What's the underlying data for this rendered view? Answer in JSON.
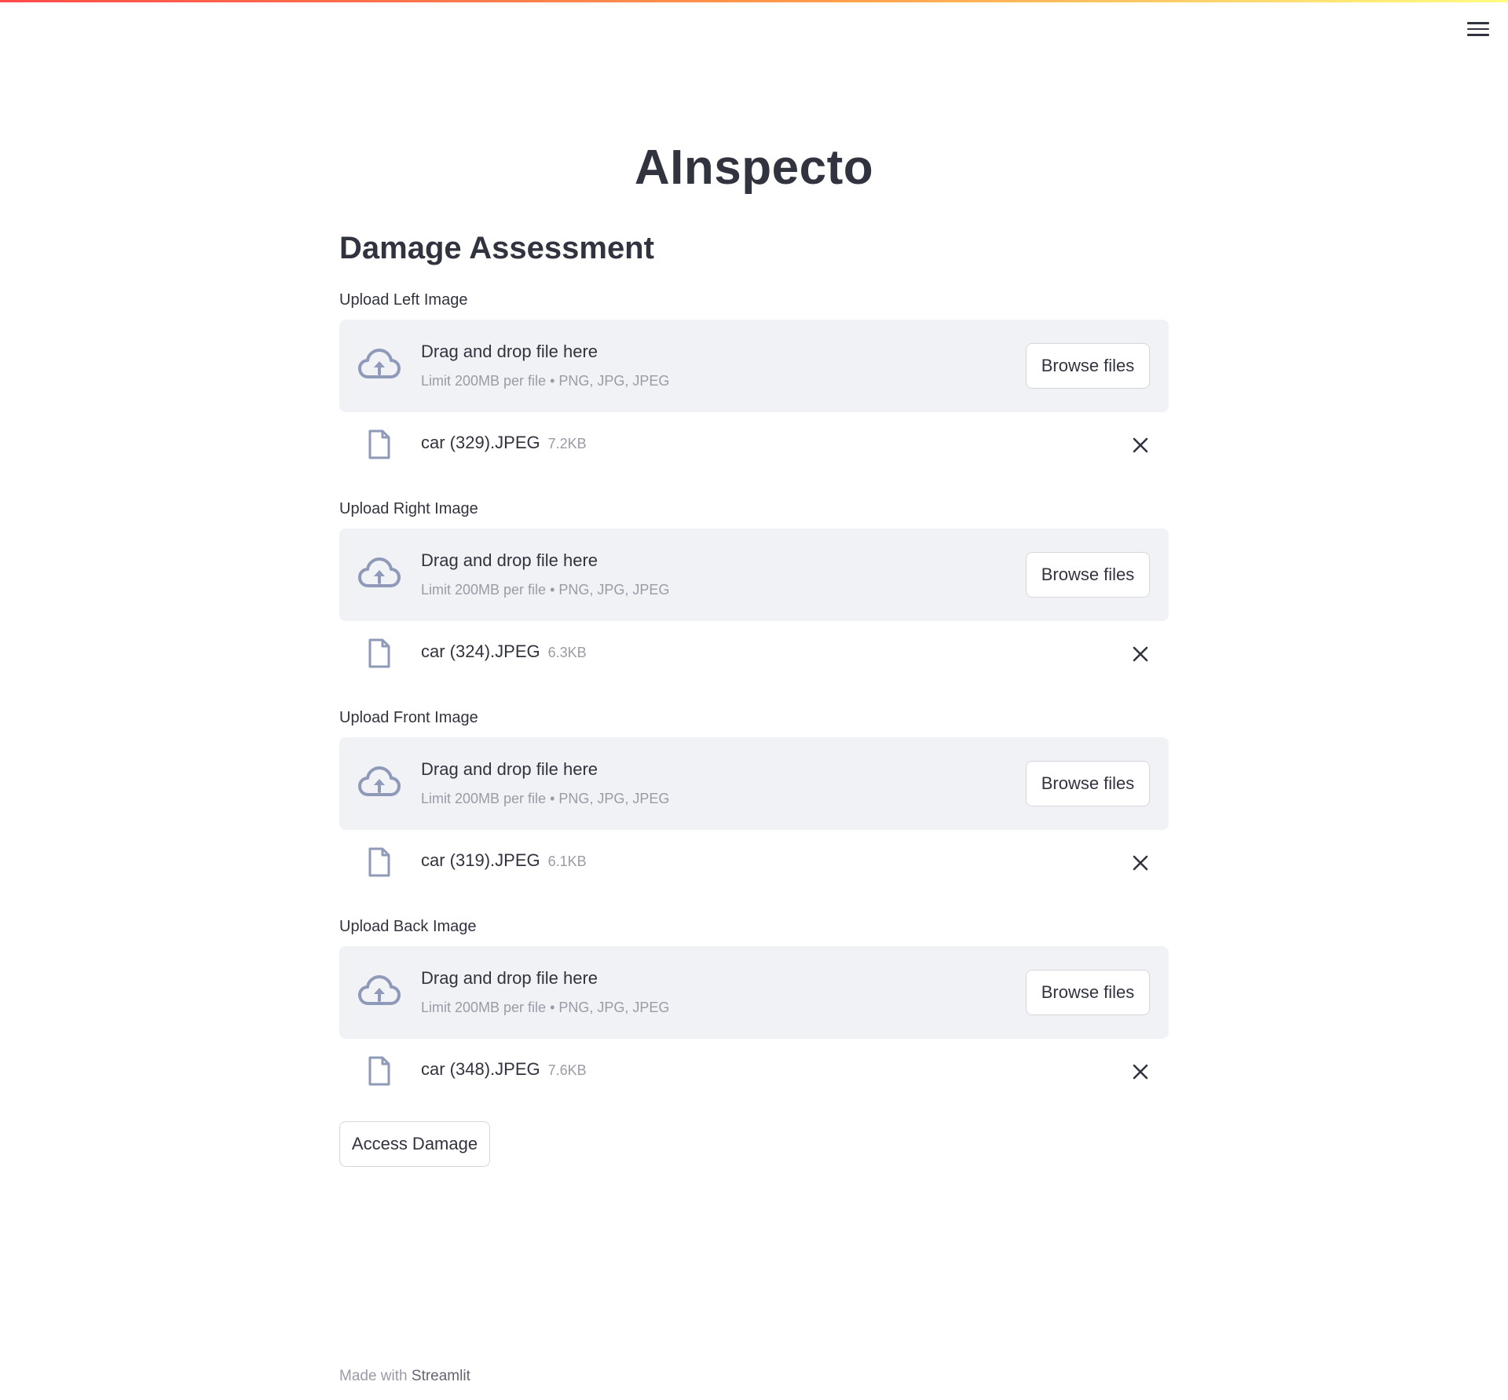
{
  "app": {
    "title": "AInspecto",
    "section_title": "Damage Assessment"
  },
  "dropzone": {
    "title": "Drag and drop file here",
    "subtitle": "Limit 200MB per file • PNG, JPG, JPEG",
    "browse_label": "Browse files"
  },
  "uploaders": [
    {
      "label": "Upload Left Image",
      "file_name": "car (329).JPEG",
      "file_size": "7.2KB"
    },
    {
      "label": "Upload Right Image",
      "file_name": "car (324).JPEG",
      "file_size": "6.3KB"
    },
    {
      "label": "Upload Front Image",
      "file_name": "car (319).JPEG",
      "file_size": "6.1KB"
    },
    {
      "label": "Upload Back Image",
      "file_name": "car (348).JPEG",
      "file_size": "7.6KB"
    }
  ],
  "actions": {
    "access_damage_label": "Access Damage"
  },
  "footer": {
    "prefix": "Made with",
    "brand": "Streamlit"
  },
  "colors": {
    "text": "#31333f",
    "muted": "#9a9ba6",
    "dropzone_bg": "#f0f2f6",
    "icon": "#8e9ab8"
  }
}
